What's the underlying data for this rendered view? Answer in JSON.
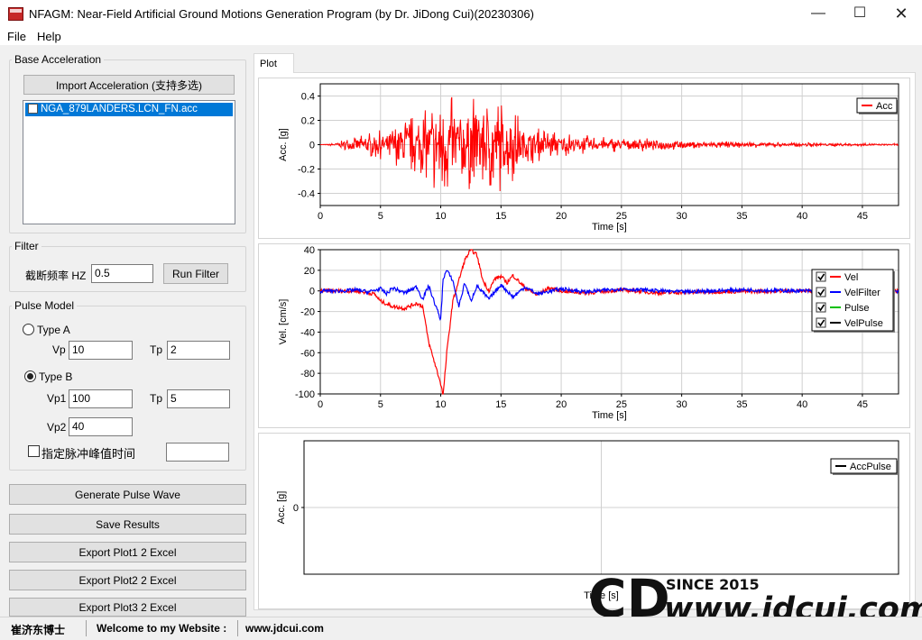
{
  "window": {
    "title": "NFAGM: Near-Field Artificial Ground Motions Generation Program (by Dr. JiDong Cui)(20230306)"
  },
  "menu": {
    "file": "File",
    "help": "Help"
  },
  "base_acc": {
    "title": "Base Acceleration",
    "import_btn": "Import Acceleration (支持多选)",
    "files": [
      "NGA_879LANDERS.LCN_FN.acc"
    ]
  },
  "filter": {
    "title": "Filter",
    "cutoff_label": "截断频率 HZ",
    "cutoff_value": "0.5",
    "run_btn": "Run Filter"
  },
  "pulse": {
    "title": "Pulse Model",
    "type_a": "Type A",
    "type_b": "Type B",
    "selected": "Type B",
    "vp_label": "Vp",
    "vp_value": "10",
    "tp_a_label": "Tp",
    "tp_a_value": "2",
    "vp1_label": "Vp1",
    "vp1_value": "100",
    "tp_b_label": "Tp",
    "tp_b_value": "5",
    "vp2_label": "Vp2",
    "vp2_value": "40",
    "peak_time_label": "指定脉冲峰值时间",
    "peak_time_value": ""
  },
  "actions": {
    "generate": "Generate Pulse Wave",
    "save": "Save Results",
    "export1": "Export Plot1 2 Excel",
    "export2": "Export Plot2 2 Excel",
    "export3": "Export Plot3 2 Excel"
  },
  "tab": {
    "plot": "Plot"
  },
  "colors": {
    "acc": "#ff0000",
    "vel": "#ff0000",
    "velfilter": "#0000ff",
    "pulse": "#00c000",
    "velpulse": "#000000"
  },
  "chart_data": [
    {
      "type": "line",
      "xlabel": "Time [s]",
      "ylabel": "Acc. [g]",
      "xlim": [
        0,
        48
      ],
      "ylim": [
        -0.5,
        0.5
      ],
      "xticks": [
        0,
        5,
        10,
        15,
        20,
        25,
        30,
        35,
        40,
        45
      ],
      "yticks": [
        -0.4,
        -0.2,
        0,
        0.2,
        0.4
      ],
      "legend": "top-right",
      "grid": true,
      "series": [
        {
          "name": "Acc",
          "color": "#ff0000",
          "x": [
            0,
            1,
            2,
            3,
            4,
            5,
            6,
            7,
            8,
            9,
            9.5,
            10,
            10.3,
            11,
            12,
            13,
            14,
            15,
            16,
            17,
            18,
            19,
            20,
            22,
            24,
            26,
            28,
            30,
            32,
            34,
            36,
            38,
            40,
            42,
            44,
            46,
            48
          ],
          "amplitude": [
            0,
            0.01,
            0.04,
            0.08,
            0.1,
            0.12,
            0.15,
            0.22,
            0.25,
            0.3,
            0.4,
            0.52,
            0.5,
            0.38,
            0.4,
            0.42,
            0.45,
            0.38,
            0.3,
            0.18,
            0.14,
            0.12,
            0.1,
            0.08,
            0.06,
            0.06,
            0.05,
            0.04,
            0.03,
            0.03,
            0.025,
            0.02,
            0.018,
            0.015,
            0.012,
            0.01,
            0.01
          ]
        }
      ]
    },
    {
      "type": "line",
      "xlabel": "Time [s]",
      "ylabel": "Vel. [cm/s]",
      "xlim": [
        0,
        48
      ],
      "ylim": [
        -100,
        40
      ],
      "xticks": [
        0,
        5,
        10,
        15,
        20,
        25,
        30,
        35,
        40,
        45
      ],
      "yticks": [
        -100,
        -80,
        -60,
        -40,
        -20,
        0,
        20,
        40
      ],
      "legend": "top-right",
      "grid": true,
      "series": [
        {
          "name": "Vel",
          "color": "#ff0000",
          "x": [
            0,
            2,
            3,
            4,
            4.5,
            5,
            6,
            7,
            8,
            8.5,
            9,
            9.5,
            10,
            10.2,
            10.5,
            11,
            11.5,
            12,
            12.5,
            13,
            13.5,
            14,
            14.5,
            15,
            15.5,
            16,
            17,
            18,
            19,
            20,
            22,
            25,
            28,
            32,
            40,
            48
          ],
          "y": [
            0,
            0,
            0,
            -2,
            -3,
            -10,
            -15,
            -17,
            -12,
            -15,
            -50,
            -70,
            -90,
            -102,
            -60,
            -10,
            10,
            30,
            40,
            35,
            10,
            0,
            12,
            14,
            8,
            15,
            3,
            -4,
            3,
            0,
            -2,
            1,
            -2,
            -1,
            0,
            0
          ]
        },
        {
          "name": "VelFilter",
          "color": "#0000ff",
          "x": [
            0,
            2,
            3,
            4,
            5,
            5.5,
            6,
            7,
            8,
            8.5,
            9,
            9.5,
            10,
            10.2,
            10.5,
            11,
            11.5,
            12,
            12.5,
            13,
            14,
            15,
            16,
            17,
            18,
            20,
            22,
            25,
            30,
            35,
            40,
            48
          ],
          "y": [
            0,
            0,
            1,
            -1,
            2,
            -3,
            3,
            -2,
            4,
            -8,
            5,
            -12,
            -28,
            12,
            20,
            10,
            -15,
            8,
            -10,
            5,
            -8,
            6,
            -6,
            4,
            -3,
            2,
            -1,
            2,
            -1,
            1,
            0,
            0
          ]
        },
        {
          "name": "Pulse",
          "color": "#00c000",
          "x": [],
          "y": []
        },
        {
          "name": "VelPulse",
          "color": "#000000",
          "x": [],
          "y": []
        }
      ]
    },
    {
      "type": "line",
      "xlabel": "Time [s]",
      "ylabel": "Acc. [g]",
      "yticks": [
        0
      ],
      "legend": "top-right",
      "grid": true,
      "series": [
        {
          "name": "AccPulse",
          "color": "#000000",
          "x": [],
          "y": []
        }
      ]
    }
  ],
  "status": {
    "name": "崔济东博士",
    "welcome": "Welcome to my Website :",
    "url": "www.jdcui.com"
  },
  "watermark": {
    "since": "SINCE 2015",
    "site": "www.jdcui.com",
    "logo": "CD"
  }
}
